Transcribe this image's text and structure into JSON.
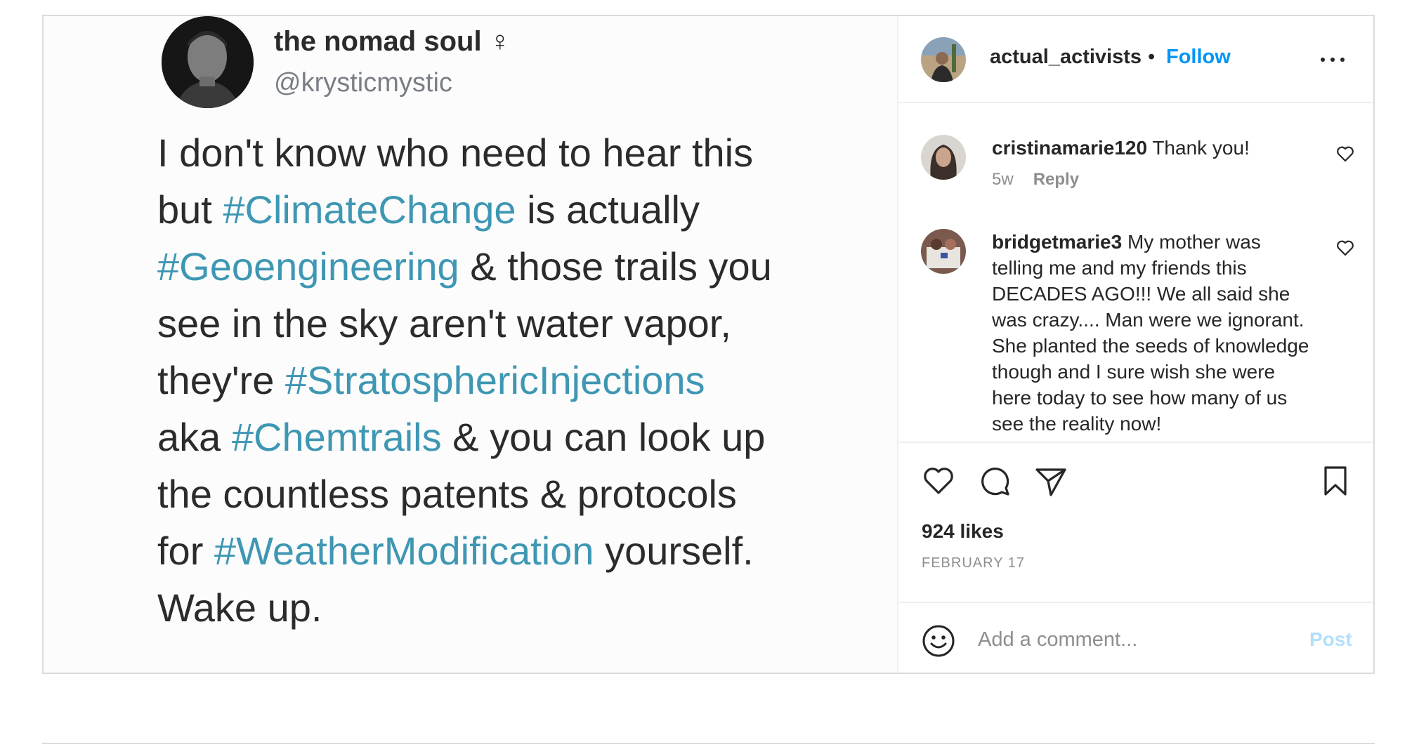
{
  "tweet": {
    "name": "the nomad soul ♀",
    "handle": "@krysticmystic",
    "lines": [
      [
        {
          "t": "I don't know who need to hear this"
        }
      ],
      [
        {
          "t": "but "
        },
        {
          "t": "#ClimateChange",
          "tag": true
        },
        {
          "t": " is actually"
        }
      ],
      [
        {
          "t": "#Geoengineering",
          "tag": true
        },
        {
          "t": " & those trails you"
        }
      ],
      [
        {
          "t": "see in the sky aren't water vapor,"
        }
      ],
      [
        {
          "t": "they're "
        },
        {
          "t": "#StratosphericInjections",
          "tag": true
        }
      ],
      [
        {
          "t": "aka "
        },
        {
          "t": "#Chemtrails",
          "tag": true
        },
        {
          "t": " & you can look up"
        }
      ],
      [
        {
          "t": "the countless patents & protocols"
        }
      ],
      [
        {
          "t": "for "
        },
        {
          "t": "#WeatherModification",
          "tag": true
        },
        {
          "t": " yourself."
        }
      ],
      [
        {
          "t": "Wake up."
        }
      ]
    ]
  },
  "header": {
    "username": "actual_activists",
    "separator": "•",
    "follow_label": "Follow"
  },
  "comments": [
    {
      "username": "cristinamarie120",
      "text": "Thank you!",
      "age": "5w",
      "reply_label": "Reply"
    },
    {
      "username": "bridgetmarie3",
      "text": "My mother was telling me and my friends this DECADES AGO!!! We all said she was crazy.... Man were we ignorant. She planted the seeds of knowledge though and I sure wish she were here today to see how many of us see the reality now!"
    }
  ],
  "stats": {
    "likes": "924 likes",
    "date": "FEBRUARY 17"
  },
  "add_comment": {
    "placeholder": "Add a comment...",
    "post_label": "Post"
  },
  "colors": {
    "link": "#0095f6",
    "hashtag": "#3e97b3",
    "post_disabled": "#b2dffc",
    "border": "#dbdbdb"
  },
  "icons": [
    "more-options-icon",
    "heart-icon",
    "comment-icon",
    "share-icon",
    "bookmark-icon",
    "emoji-icon"
  ]
}
